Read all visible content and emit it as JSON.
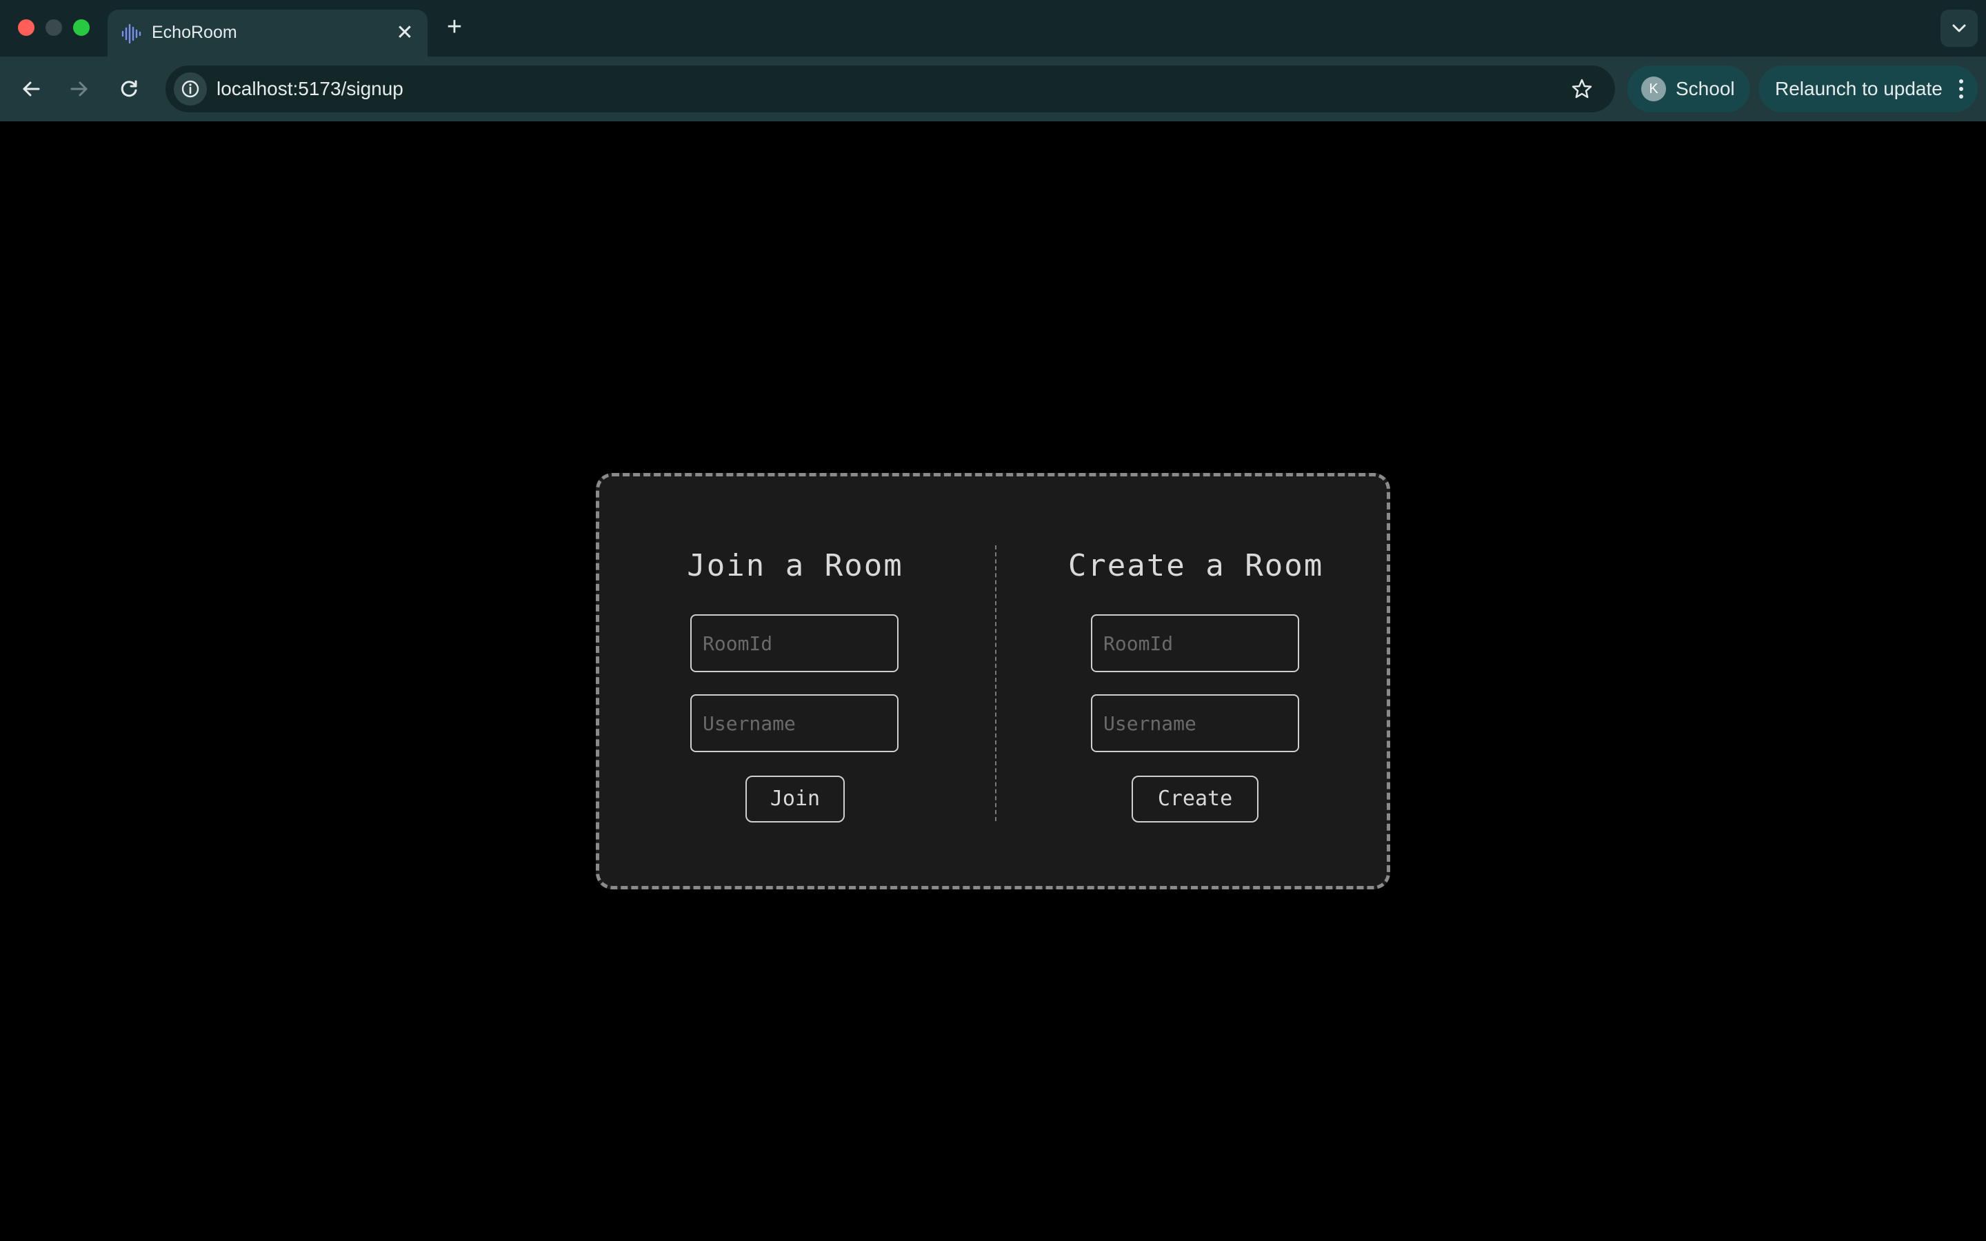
{
  "browser": {
    "tab": {
      "title": "EchoRoom",
      "close_glyph": "✕",
      "favicon": "sound-wave-icon"
    },
    "new_tab_glyph": "+",
    "address_bar": {
      "url": "localhost:5173/signup"
    },
    "profile": {
      "initial": "K",
      "label": "School"
    },
    "relaunch": {
      "label": "Relaunch to update"
    },
    "colors": {
      "tabstrip": "#13272a",
      "toolbar": "#213a3e",
      "chip": "#17474a"
    }
  },
  "page": {
    "join": {
      "title": "Join a Room",
      "roomid_placeholder": "RoomId",
      "username_placeholder": "Username",
      "button_label": "Join"
    },
    "create": {
      "title": "Create a Room",
      "roomid_placeholder": "RoomId",
      "username_placeholder": "Username",
      "button_label": "Create"
    },
    "colors": {
      "background": "#000000",
      "card": "#1b1b1c",
      "card_border": "#8a8a8a",
      "text": "#d9d9d9"
    }
  }
}
